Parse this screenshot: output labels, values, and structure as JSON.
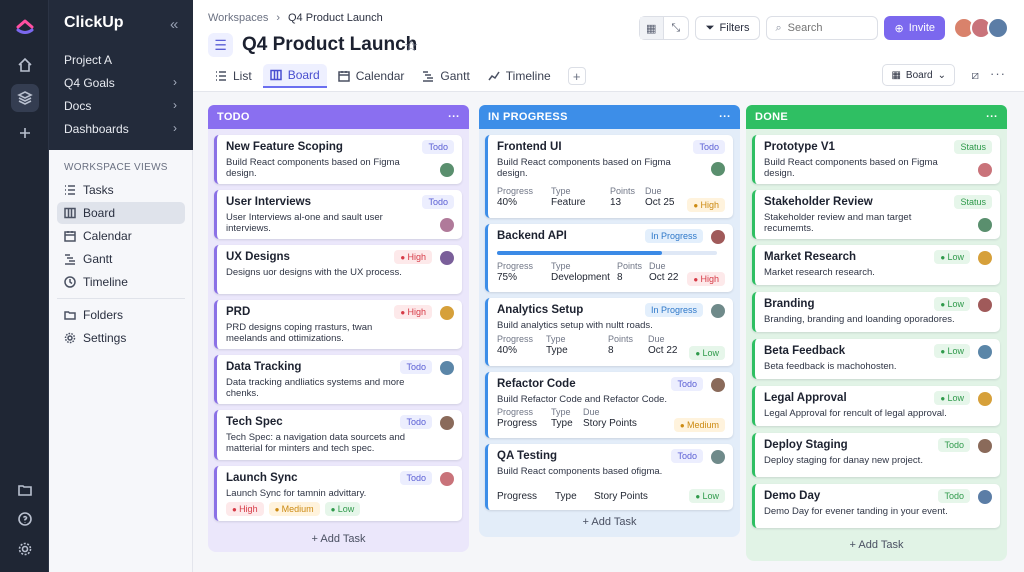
{
  "brand": {
    "name": "ClickUp"
  },
  "sidebar": {
    "items": [
      {
        "label": "Project A"
      },
      {
        "label": "Q4 Goals"
      },
      {
        "label": "Docs"
      },
      {
        "label": "Dashboards"
      }
    ],
    "views_title": "WORKSPACE VIEWS",
    "views": [
      {
        "label": "Tasks",
        "icon": "list-icon"
      },
      {
        "label": "Board",
        "icon": "board-icon"
      },
      {
        "label": "Calendar",
        "icon": "calendar-icon"
      },
      {
        "label": "Gantt",
        "icon": "gantt-icon"
      },
      {
        "label": "Timeline",
        "icon": "timeline-icon"
      },
      {
        "label": "Folders",
        "icon": "folder-icon"
      },
      {
        "label": "Settings",
        "icon": "gear-icon"
      }
    ]
  },
  "header": {
    "breadcrumb": [
      "Workspaces",
      "Q4 Product Launch"
    ],
    "title": "Q4 Product Launch",
    "tabs": [
      {
        "label": "List"
      },
      {
        "label": "Board"
      },
      {
        "label": "Calendar"
      },
      {
        "label": "Gantt"
      },
      {
        "label": "Timeline"
      }
    ],
    "filters_label": "Filters",
    "search_placeholder": "Search",
    "invite_label": "Invite",
    "board_select": "Board"
  },
  "colors": {
    "todo": "#8a6ff0",
    "in_progress": "#3d8ee8",
    "done": "#2fbf63",
    "accent": "#7b68ee"
  },
  "columns": {
    "todo": {
      "title": "TODO",
      "add_label": "+ Add Task",
      "cards": [
        {
          "title": "New Feature Scoping",
          "desc": "Build React components based on Figma design.",
          "badge": "Todo"
        },
        {
          "title": "User Interviews",
          "desc": "User Interviews al-one and sault user interviews.",
          "badge": "Todo"
        },
        {
          "title": "UX Designs",
          "desc": "Designs uor designs with the UX process.",
          "badge": "High"
        },
        {
          "title": "PRD",
          "desc": "PRD designs coping rrasturs, twan meelands and ottimizations.",
          "badge": "High"
        },
        {
          "title": "Data Tracking",
          "desc": "Data tracking andliatics systems and more chenks.",
          "badge": "Todo"
        },
        {
          "title": "Tech Spec",
          "desc": "Tech Spec: a navigation data sourcets and matterial for minters and tech spec.",
          "badge": "Todo"
        },
        {
          "title": "Launch Sync",
          "desc": "Launch Sync for tamnin advittary.",
          "badge": "Todo",
          "tags": [
            "High",
            "Medium",
            "Low"
          ]
        }
      ]
    },
    "in_progress": {
      "title": "IN PROGRESS",
      "add_label": "+ Add Task",
      "meta_keys": [
        "Progress",
        "Type",
        "Points",
        "Due"
      ],
      "cards": [
        {
          "title": "Frontend UI",
          "desc": "Build React components based on Figma design.",
          "badge": "Todo",
          "progress": "40%",
          "type": "Feature",
          "points": "13",
          "due": "Oct 25",
          "priority": "High"
        },
        {
          "title": "Backend API",
          "badge": "In Progress",
          "progress_fill": 0.75,
          "progress": "75%",
          "type": "Development",
          "points": "8",
          "due": "Oct 22",
          "priority": "High"
        },
        {
          "title": "Analytics Setup",
          "desc": "Build analytics setup with nultt roads.",
          "badge": "In Progress",
          "progress": "40%",
          "type": "Type",
          "points": "8",
          "due": "Oct 22",
          "priority": "Low"
        },
        {
          "title": "Refactor Code",
          "desc": "Build Refactor Code and Refactor Code.",
          "badge": "Todo",
          "meta_keys": [
            "Progress",
            "Type",
            "Due"
          ],
          "progress": "Progress",
          "type": "Type",
          "due": "Story Points",
          "priority": "Medium"
        },
        {
          "title": "QA Testing",
          "desc": "Build React components based ofigma.",
          "badge": "Todo",
          "progress": "Progress",
          "type": "Type",
          "due": "Story Points",
          "priority": "Low"
        }
      ]
    },
    "done": {
      "title": "DONE",
      "add_label": "+ Add Task",
      "cards": [
        {
          "title": "Prototype V1",
          "desc": "Build React components based on Figma design.",
          "badge": "Status"
        },
        {
          "title": "Stakeholder Review",
          "desc": "Stakeholder review and man target recumemts.",
          "badge": "Status"
        },
        {
          "title": "Market Research",
          "desc": "Market research research.",
          "badge": "Low"
        },
        {
          "title": "Branding",
          "desc": "Branding, branding and loanding oporadores.",
          "badge": "Low"
        },
        {
          "title": "Beta Feedback",
          "desc": "Beta feedback is machohosten.",
          "badge": "Low"
        },
        {
          "title": "Legal Approval",
          "desc": "Legal Approval for rencult of legal approval.",
          "badge": "Low"
        },
        {
          "title": "Deploy Staging",
          "desc": "Deploy staging for danay new project.",
          "badge": "Todo"
        },
        {
          "title": "Demo Day",
          "desc": "Demo Day for evener tanding in your event.",
          "badge": "Todo"
        }
      ]
    }
  }
}
